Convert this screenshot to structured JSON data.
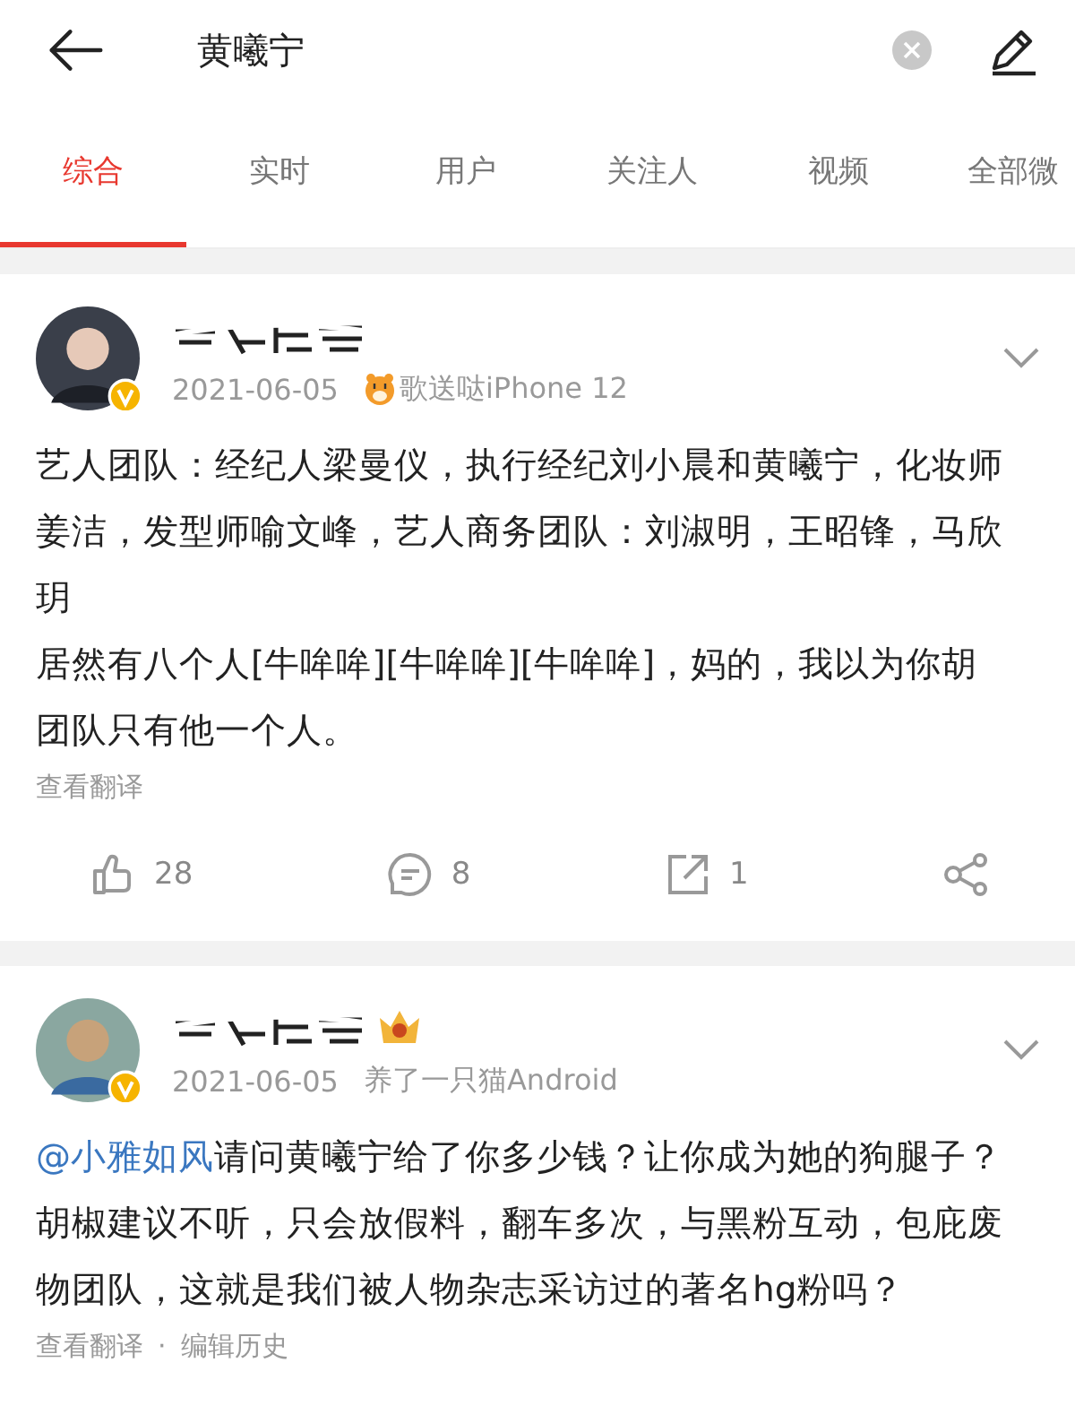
{
  "search_bar": {
    "value": "黄曦宁"
  },
  "tabs": [
    {
      "label": "综合",
      "selected": true
    },
    {
      "label": "实时",
      "selected": false
    },
    {
      "label": "用户",
      "selected": false
    },
    {
      "label": "关注人",
      "selected": false
    },
    {
      "label": "视频",
      "selected": false
    },
    {
      "label": "全部微",
      "selected": false
    }
  ],
  "posts": [
    {
      "verified": true,
      "date": "2021-06-05",
      "source": "歌送哒iPhone 12",
      "source_badge": true,
      "level_badge": false,
      "paragraphs": [
        "艺人团队：经纪人梁曼仪，执行经纪刘小晨和黄曦宁，化妆师姜洁，发型师喻文峰，艺人商务团队：刘淑明，王昭锋，马欣玥",
        "居然有八个人[牛哞哞][牛哞哞][牛哞哞]，妈的，我以为你胡团队只有他一个人。"
      ],
      "links": [
        "查看翻译"
      ],
      "actions": {
        "likes": "28",
        "comments": "8",
        "reposts": "1"
      }
    },
    {
      "verified": true,
      "date": "2021-06-05",
      "source": "养了一只猫Android",
      "source_badge": false,
      "level_badge": true,
      "mention": "@小雅如风",
      "paragraphs": [
        "请问黄曦宁给了你多少钱？让你成为她的狗腿子？胡椒建议不听，只会放假料，翻车多次，与黑粉互动，包庇废物团队，这就是我们被人物杂志采访过的著名hg粉吗？"
      ],
      "links": [
        "查看翻译",
        "编辑历史"
      ],
      "link_separator": "·"
    }
  ]
}
